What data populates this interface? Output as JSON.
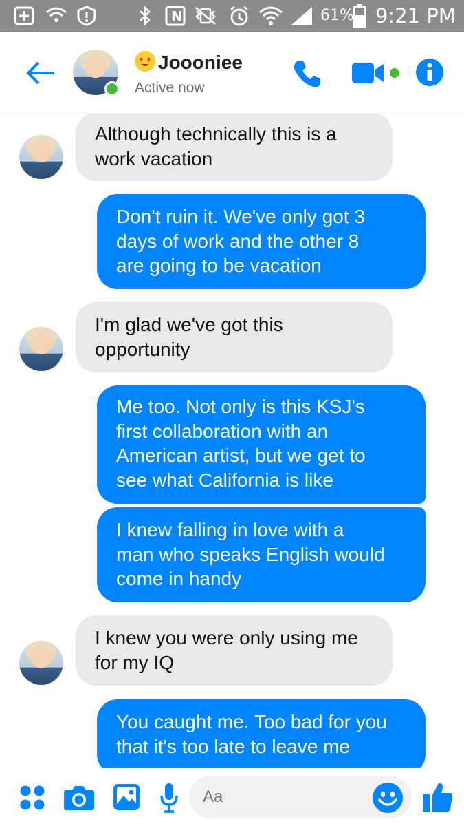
{
  "status_bar": {
    "battery_percent": "61%",
    "time": "9:21 PM"
  },
  "header": {
    "contact_name": "Joooniee",
    "contact_status": "Active now",
    "accent_color": "#0084ff",
    "online_color": "#44bd32"
  },
  "messages": [
    {
      "direction": "in",
      "text": "Although technically this is a\nwork vacation"
    },
    {
      "direction": "out",
      "text": "Don't ruin it. We've only got 3\ndays of work and the other 8\nare going to be vacation"
    },
    {
      "direction": "in",
      "text": "I'm glad we've got this\nopportunity"
    },
    {
      "direction": "out",
      "text": "Me too. Not only is this KSJ's\nfirst collaboration with an\nAmerican artist, but we get to\nsee what California is like"
    },
    {
      "direction": "out",
      "text": "I knew falling in love with a\nman who speaks English would\ncome in handy"
    },
    {
      "direction": "in",
      "text": "I knew you were only using me\nfor my IQ"
    },
    {
      "direction": "out",
      "text": "You caught me. Too bad for you\nthat it's too late to leave me"
    }
  ],
  "composer": {
    "placeholder": "Aa"
  },
  "icons": {
    "status": [
      "add-icon",
      "wifi-call-icon",
      "alert-shield-icon",
      "bluetooth-icon",
      "nfc-icon",
      "vibrate-mute-icon",
      "alarm-icon",
      "wifi-icon",
      "signal-icon",
      "battery-icon"
    ],
    "header": [
      "back-arrow-icon",
      "phone-icon",
      "video-camera-icon",
      "info-icon"
    ],
    "composer": [
      "apps-grid-icon",
      "camera-icon",
      "gallery-icon",
      "microphone-icon",
      "emoji-icon",
      "thumbs-up-icon"
    ]
  }
}
